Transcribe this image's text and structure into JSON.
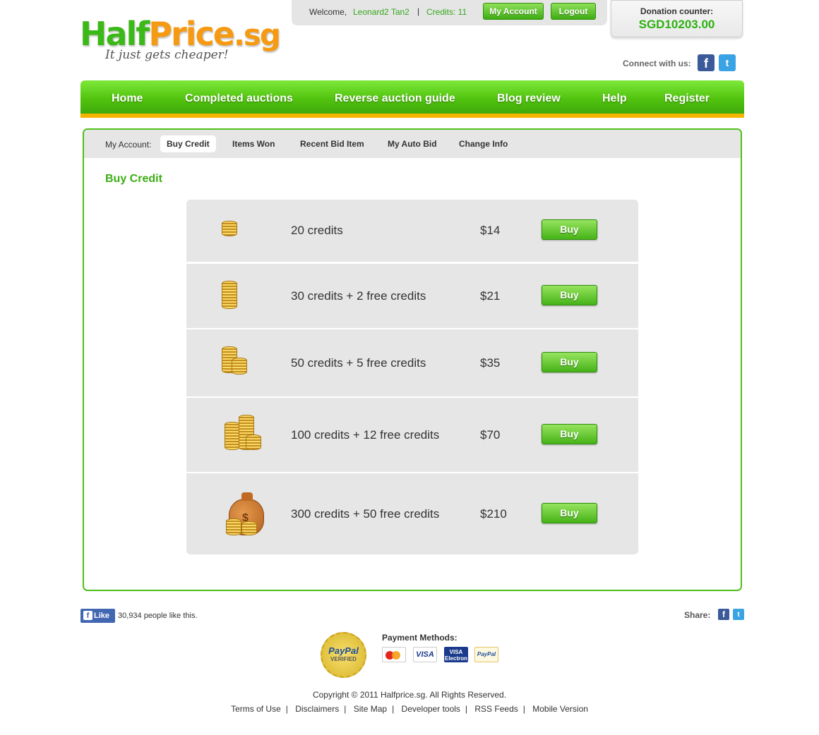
{
  "logo": {
    "half": "Half",
    "price": "Price",
    "sg": ".sg",
    "tagline": "It just gets cheaper!"
  },
  "topbar": {
    "welcome": "Welcome,",
    "username": "Leonard2 Tan2",
    "separator": "|",
    "credits": "Credits: 11",
    "my_account_label": "My Account",
    "logout_label": "Logout"
  },
  "donation": {
    "label": "Donation counter:",
    "amount": "SGD10203.00"
  },
  "connect": {
    "label": "Connect with us:",
    "facebook_icon": "facebook-icon",
    "twitter_icon": "twitter-icon"
  },
  "nav": {
    "items": [
      "Home",
      "Completed auctions",
      "Reverse auction guide",
      "Blog review",
      "Help",
      "Register"
    ]
  },
  "account_tabs": {
    "label": "My Account:",
    "tabs": [
      "Buy Credit",
      "Items Won",
      "Recent Bid Item",
      "My Auto Bid",
      "Change Info"
    ],
    "active": "Buy Credit"
  },
  "heading": "Buy Credit",
  "packages": [
    {
      "label": "20 credits",
      "price": "$14",
      "buy": "Buy",
      "icon": "coin-stack-icon"
    },
    {
      "label": "30 credits + 2 free credits",
      "price": "$21",
      "buy": "Buy",
      "icon": "coin-stack-icon"
    },
    {
      "label": "50 credits + 5 free credits",
      "price": "$35",
      "buy": "Buy",
      "icon": "coin-stacks-icon"
    },
    {
      "label": "100 credits + 12 free credits",
      "price": "$70",
      "buy": "Buy",
      "icon": "coin-stacks-icon"
    },
    {
      "label": "300 credits + 50 free credits",
      "price": "$210",
      "buy": "Buy",
      "icon": "money-bag-icon"
    }
  ],
  "footer": {
    "like_label": "Like",
    "like_count": "30,934 people like this.",
    "share_label": "Share:",
    "paypal_seal": {
      "line1": "PayPal",
      "line2": "VERIFIED"
    },
    "payment_methods_label": "Payment Methods:",
    "cards": {
      "mastercard": "MasterCard",
      "visa": "VISA",
      "visa_electron": "VISA Electron",
      "paypal": "PayPal"
    },
    "copyright": "Copyright © 2011 Halfprice.sg. All Rights Reserved.",
    "links": [
      "Terms of Use",
      "Disclaimers",
      "Site Map",
      "Developer tools",
      "RSS Feeds",
      "Mobile Version"
    ]
  },
  "colors": {
    "brand_green": "#4fbf19",
    "brand_orange": "#f59a12",
    "nav_underline": "#f6b400",
    "credit_text": "#35a81a"
  }
}
